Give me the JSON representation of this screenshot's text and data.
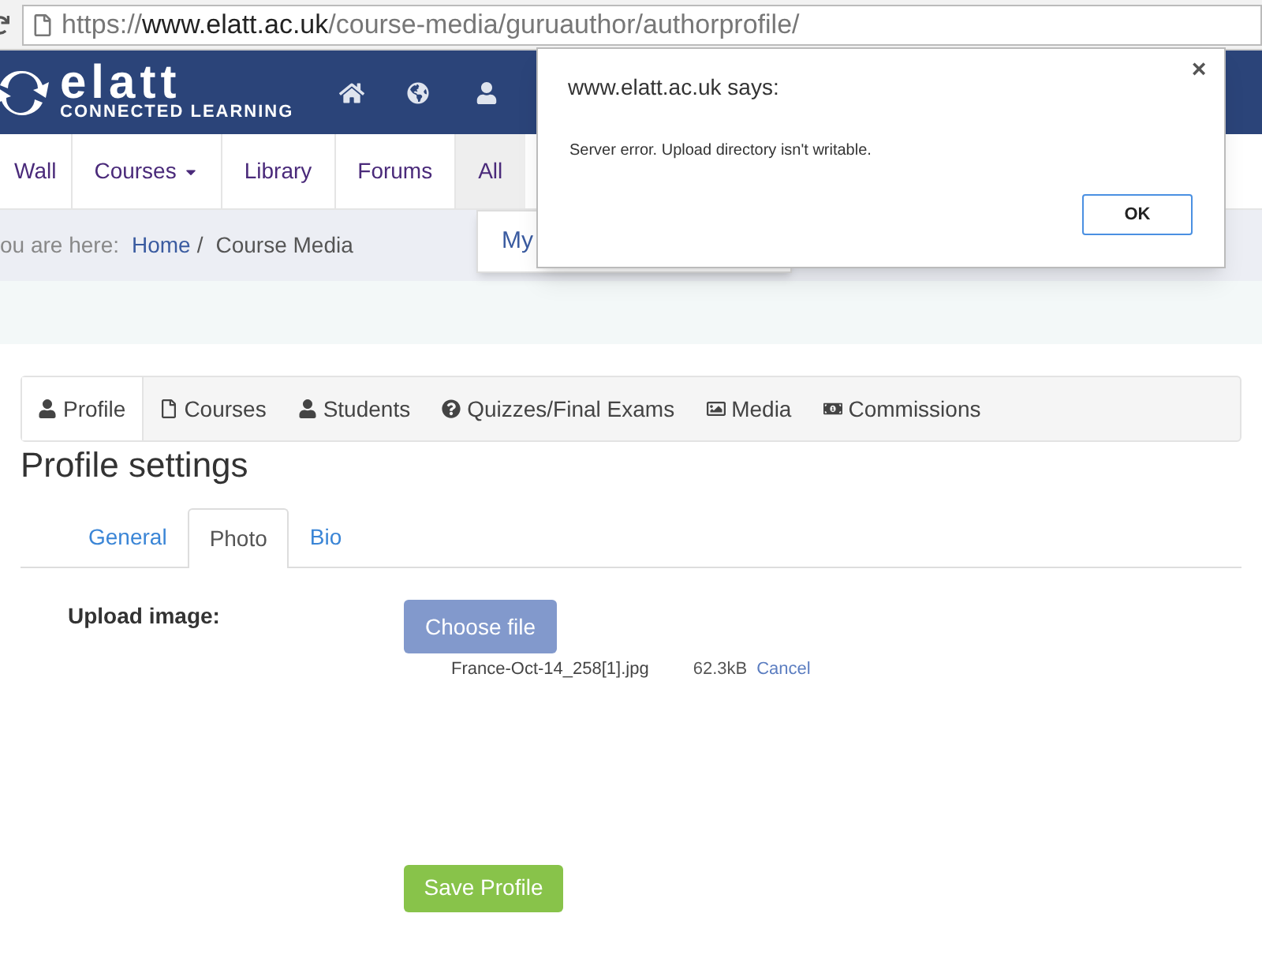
{
  "address_bar": {
    "scheme": "https://",
    "host": "www.elatt.ac.uk",
    "path": "/course-media/guruauthor/authorprofile/"
  },
  "logo": {
    "name": "elatt",
    "tagline": "CONNECTED LEARNING"
  },
  "nav": [
    {
      "label": "Wall",
      "dropdown": false,
      "selected": false
    },
    {
      "label": "Courses",
      "dropdown": true,
      "selected": false
    },
    {
      "label": "Library",
      "dropdown": false,
      "selected": false
    },
    {
      "label": "Forums",
      "dropdown": false,
      "selected": false
    },
    {
      "label": "All",
      "dropdown": false,
      "selected": true
    }
  ],
  "nav_menu": {
    "items": [
      "My"
    ]
  },
  "breadcrumb": {
    "prefix": "ou are here:",
    "items": [
      {
        "label": "Home",
        "link": true
      },
      {
        "label": "Course Media",
        "link": false
      }
    ],
    "separator": "/"
  },
  "profile_tabs": [
    {
      "label": "Profile",
      "selected": true
    },
    {
      "label": "Courses",
      "selected": false
    },
    {
      "label": "Students",
      "selected": false
    },
    {
      "label": "Quizzes/Final Exams",
      "selected": false
    },
    {
      "label": "Media",
      "selected": false
    },
    {
      "label": "Commissions",
      "selected": false
    }
  ],
  "heading": "Profile settings",
  "sub_tabs": [
    {
      "label": "General",
      "selected": false
    },
    {
      "label": "Photo",
      "selected": true
    },
    {
      "label": "Bio",
      "selected": false
    }
  ],
  "upload": {
    "label": "Upload image:",
    "button": "Choose file",
    "file_name": "France-Oct-14_258[1].jpg",
    "file_size": "62.3kB",
    "cancel": "Cancel"
  },
  "save_button": "Save Profile",
  "dialog": {
    "title": "www.elatt.ac.uk says:",
    "message": "Server error. Upload directory isn't writable.",
    "close": "×",
    "ok": "OK"
  }
}
